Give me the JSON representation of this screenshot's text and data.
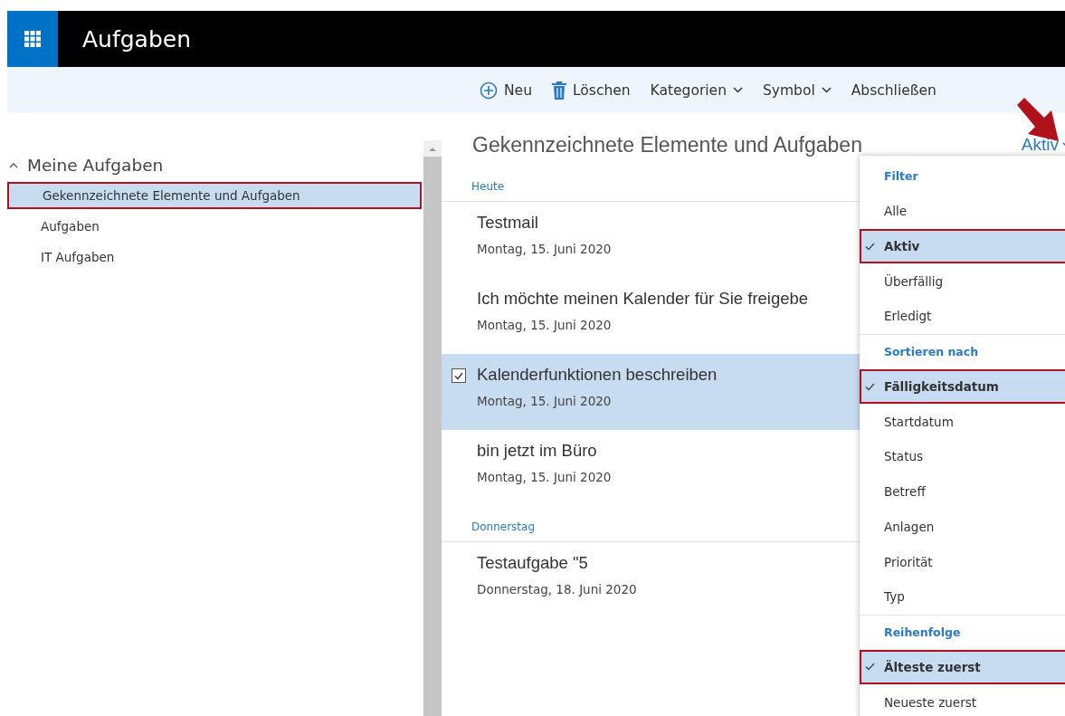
{
  "app_bar": {
    "title": "Aufgaben"
  },
  "toolbar": [
    {
      "kind": "add",
      "label": "Neu"
    },
    {
      "kind": "delete",
      "label": "Löschen"
    },
    {
      "kind": "dropdown",
      "label": "Kategorien"
    },
    {
      "kind": "dropdown",
      "label": "Symbol"
    },
    {
      "kind": "plain",
      "label": "Abschließen"
    }
  ],
  "sidebar": {
    "label": "Meine Aufgaben",
    "expanded": true,
    "children": [
      {
        "label": "Gekennzeichnete Elemente und Aufgaben",
        "selected": true,
        "annotated": true
      },
      {
        "label": "Aufgaben",
        "selected": false,
        "annotated": false
      },
      {
        "label": "IT Aufgaben",
        "selected": false,
        "annotated": false
      }
    ]
  },
  "list": {
    "title": "Gekennzeichnete Elemente und Aufgaben",
    "filter_button": "Aktiv",
    "filter_annotated": true,
    "groups": [
      {
        "label": "Heute",
        "items": [
          {
            "title": "Testmail",
            "date": "Montag, 15. Juni 2020",
            "selected": false
          },
          {
            "title": "Ich möchte meinen Kalender für Sie freigebe",
            "date": "Montag, 15. Juni 2020",
            "selected": false
          },
          {
            "title": "Kalenderfunktionen beschreiben",
            "date": "Montag, 15. Juni 2020",
            "selected": true
          },
          {
            "title": "bin jetzt im Büro",
            "date": "Montag, 15. Juni 2020",
            "selected": false
          }
        ]
      },
      {
        "label": "Donnerstag",
        "items": [
          {
            "title": "Testaufgabe \"5",
            "date": "Donnerstag, 18. Juni 2020",
            "selected": false
          }
        ]
      }
    ]
  },
  "menu": [
    {
      "heading": "Filter",
      "items": [
        {
          "label": "Alle",
          "checked": false,
          "annotated": false
        },
        {
          "label": "Aktiv",
          "checked": true,
          "annotated": true
        },
        {
          "label": "Überfällig",
          "checked": false,
          "annotated": false
        },
        {
          "label": "Erledigt",
          "checked": false,
          "annotated": false
        }
      ]
    },
    {
      "heading": "Sortieren nach",
      "items": [
        {
          "label": "Fälligkeitsdatum",
          "checked": true,
          "annotated": true
        },
        {
          "label": "Startdatum",
          "checked": false,
          "annotated": false
        },
        {
          "label": "Status",
          "checked": false,
          "annotated": false
        },
        {
          "label": "Betreff",
          "checked": false,
          "annotated": false
        },
        {
          "label": "Anlagen",
          "checked": false,
          "annotated": false
        },
        {
          "label": "Priorität",
          "checked": false,
          "annotated": false
        },
        {
          "label": "Typ",
          "checked": false,
          "annotated": false
        }
      ]
    },
    {
      "heading": "Reihenfolge",
      "items": [
        {
          "label": "Älteste zuerst",
          "checked": true,
          "annotated": true
        },
        {
          "label": "Neueste zuerst",
          "checked": false,
          "annotated": false
        }
      ]
    }
  ]
}
